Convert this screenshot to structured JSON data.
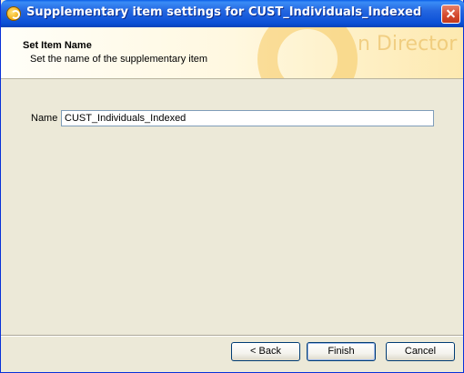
{
  "window": {
    "title": "Supplementary item settings for CUST_Individuals_Indexed"
  },
  "header": {
    "title": "Set Item Name",
    "subtitle": "Set the name of the supplementary item",
    "logo_text": "n Director"
  },
  "form": {
    "name_label": "Name",
    "name_value": "CUST_Individuals_Indexed"
  },
  "buttons": {
    "back": "< Back",
    "finish": "Finish",
    "cancel": "Cancel"
  },
  "icons": {
    "title_icon": "app-icon",
    "close_icon": "close-icon"
  }
}
